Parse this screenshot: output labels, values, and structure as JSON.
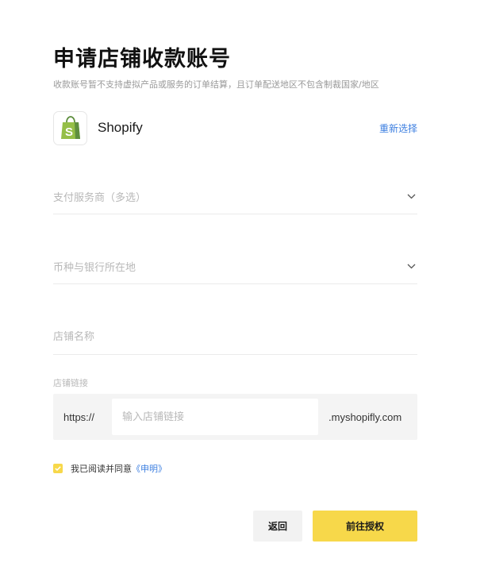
{
  "header": {
    "title": "申请店铺收款账号",
    "subtitle": "收款账号暂不支持虚拟产品或服务的订单结算，且订单配送地区不包含制裁国家/地区"
  },
  "platform": {
    "name": "Shopify",
    "reselect_label": "重新选择",
    "logo_color": "#95bf47"
  },
  "form": {
    "payment_provider_placeholder": "支付服务商（多选）",
    "currency_bank_placeholder": "币种与银行所在地",
    "store_name_placeholder": "店铺名称",
    "store_link_label": "店铺链接",
    "store_link_prefix": "https://",
    "store_link_placeholder": "输入店铺链接",
    "store_link_suffix": ".myshopifly.com"
  },
  "agreement": {
    "checked": true,
    "text": "我已阅读并同意",
    "link_label": "《申明》"
  },
  "actions": {
    "back_label": "返回",
    "authorize_label": "前往授权"
  },
  "colors": {
    "accent": "#f7d84a",
    "link": "#3d7fe0"
  }
}
